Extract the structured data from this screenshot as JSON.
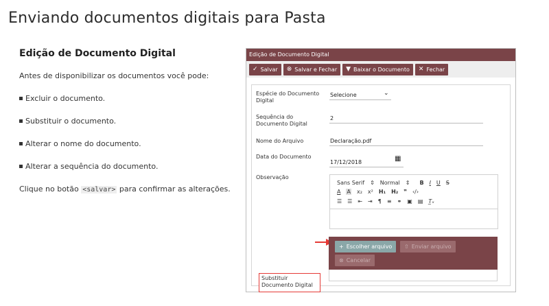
{
  "page": {
    "title": "Enviando documentos digitais para Pasta"
  },
  "left": {
    "heading": "Edição de Documento Digital",
    "intro": "Antes de disponibilizar os documentos você pode:",
    "bullets": [
      "Excluir o documento.",
      "Substituir o documento.",
      "Alterar o nome do documento.",
      "Alterar a sequência do documento."
    ],
    "footer_before": "Clique no botão ",
    "footer_code": "<salvar>",
    "footer_after": " para confirmar as alterações."
  },
  "dialog": {
    "title": "Edição de Documento Digital",
    "toolbar": {
      "save": "Salvar",
      "save_close": "Salvar e Fechar",
      "download": "Baixar o Documento",
      "close": "Fechar"
    },
    "fields": {
      "especie_label": "Espécie do Documento Digital",
      "especie_value": "Selecione",
      "sequencia_label": "Sequência do Documento Digital",
      "sequencia_value": "2",
      "nome_label": "Nome do Arquivo",
      "nome_value": "Declaração.pdf",
      "data_label": "Data do Documento",
      "data_value": "17/12/2018",
      "observacao_label": "Observação"
    },
    "editor": {
      "font": "Sans Serif",
      "size": "Normal"
    },
    "substituir_label": "Substituir Documento Digital",
    "upload": {
      "choose": "Escolher arquivo",
      "send": "Enviar arquivo",
      "cancel": "Cancelar"
    },
    "colors": {
      "accent": "#7a4448",
      "highlight": "#e53935"
    }
  }
}
